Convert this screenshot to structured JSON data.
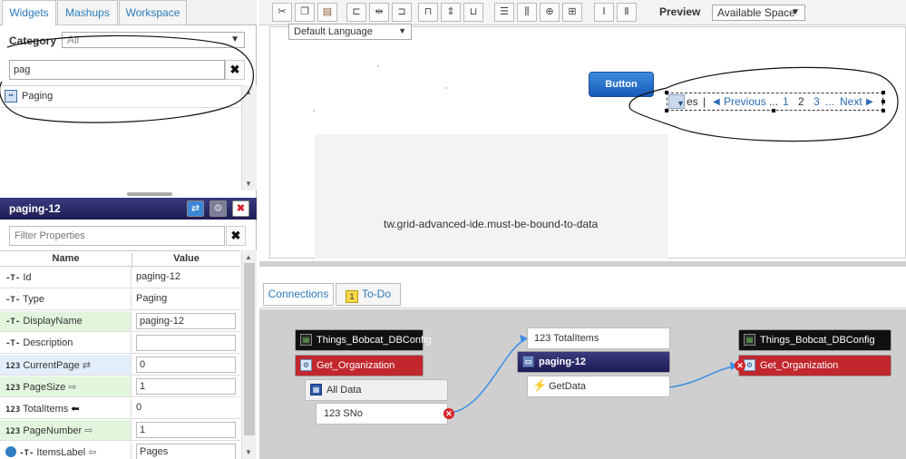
{
  "left_tabs": {
    "widgets": "Widgets",
    "mashups": "Mashups",
    "workspace": "Workspace"
  },
  "category": {
    "label": "Category",
    "value": "All"
  },
  "search": {
    "value": "pag"
  },
  "widget_list": [
    {
      "label": "Paging"
    }
  ],
  "properties": {
    "title": "paging-12",
    "filter_placeholder": "Filter Properties",
    "col_name": "Name",
    "col_value": "Value",
    "rows": [
      {
        "type_tag": "-T-",
        "name": "Id",
        "value": "paging-12"
      },
      {
        "type_tag": "-T-",
        "name": "Type",
        "value": "Paging"
      },
      {
        "type_tag": "-T-",
        "name": "DisplayName",
        "value": "paging-12"
      },
      {
        "type_tag": "-T-",
        "name": "Description",
        "value": ""
      },
      {
        "type_tag": "123",
        "name": "CurrentPage",
        "value": "0"
      },
      {
        "type_tag": "123",
        "name": "PageSize",
        "value": "1"
      },
      {
        "type_tag": "123",
        "name": "TotalItems",
        "value": "0"
      },
      {
        "type_tag": "123",
        "name": "PageNumber",
        "value": "1"
      },
      {
        "type_tag": "-T-",
        "name": "ItemsLabel",
        "value": "Pages"
      }
    ]
  },
  "toolbar": {
    "preview_label": "Preview",
    "preview_value": "Available Space"
  },
  "canvas": {
    "language_select": "Default Language",
    "button_label": "Button",
    "grid_message": "tw.grid-advanced-ide.must-be-bound-to-data",
    "pager": {
      "label_fragment": "es",
      "separator": "|",
      "previous": "Previous",
      "ellipsis_left": "...",
      "pages": [
        "1",
        "2",
        "3"
      ],
      "ellipsis_right": "...",
      "next": "Next"
    }
  },
  "bottom_tabs": {
    "connections": "Connections",
    "todo": "To-Do"
  },
  "connections": {
    "left": {
      "thing": "Things_Bobcat_DBConfig",
      "service": "Get_Organization",
      "data": "All Data",
      "field_tag": "123",
      "field": "SNo"
    },
    "middle": {
      "target_tag": "123",
      "target": "TotalItems",
      "widget": "paging-12",
      "event": "GetData"
    },
    "right": {
      "thing": "Things_Bobcat_DBConfig",
      "service": "Get_Organization"
    }
  }
}
